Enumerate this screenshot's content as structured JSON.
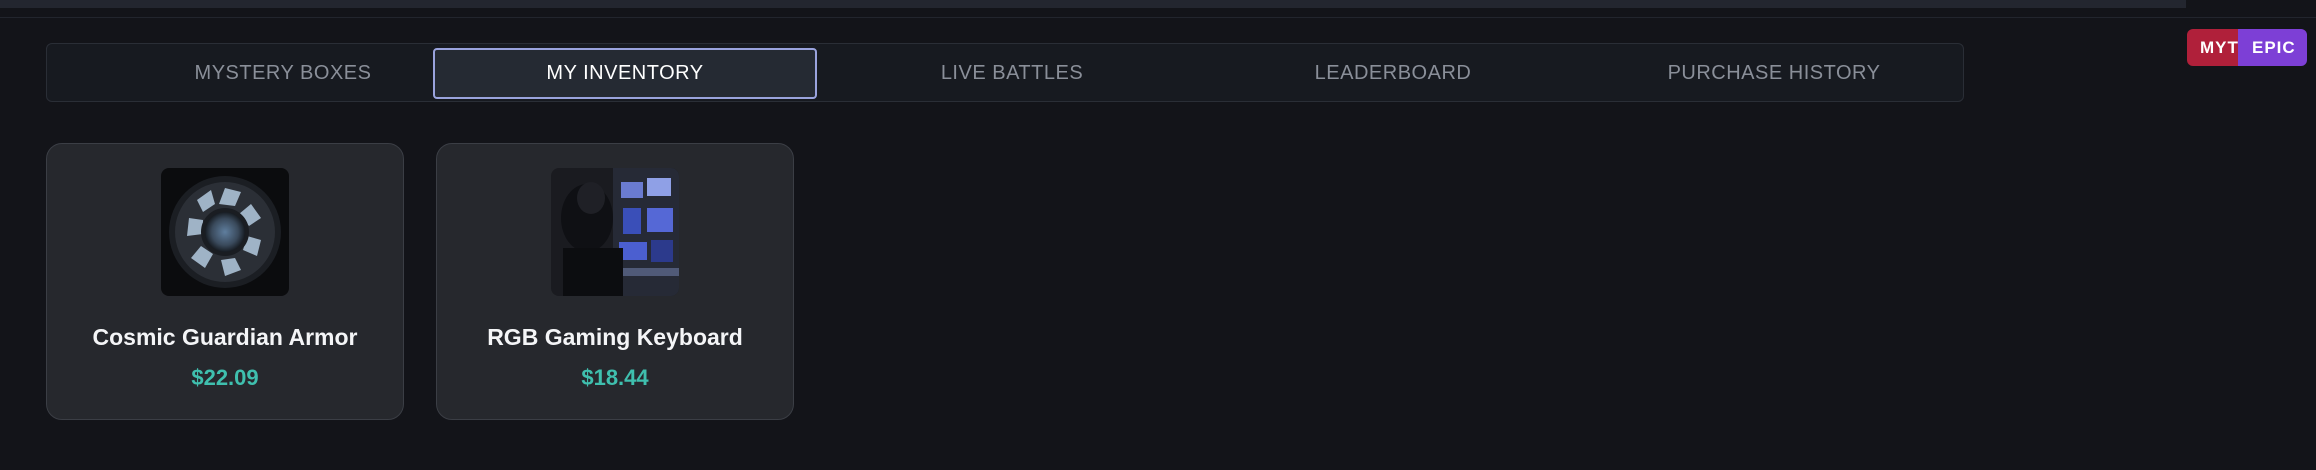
{
  "nav": {
    "tabs": [
      {
        "label": "MYSTERY BOXES",
        "active": false
      },
      {
        "label": "MY INVENTORY",
        "active": true
      },
      {
        "label": "LIVE BATTLES",
        "active": false
      },
      {
        "label": "LEADERBOARD",
        "active": false
      },
      {
        "label": "PURCHASE HISTORY",
        "active": false
      }
    ]
  },
  "badges": {
    "myth": "MYTH",
    "epic": "EPIC"
  },
  "inventory": {
    "items": [
      {
        "name": "Cosmic Guardian Armor",
        "price": "$22.09",
        "image_icon": "space-station-window-image"
      },
      {
        "name": "RGB Gaming Keyboard",
        "price": "$18.44",
        "image_icon": "gaming-setup-image"
      }
    ]
  },
  "colors": {
    "background": "#131419",
    "active_tab_border": "#9aa3dd",
    "price": "#3fbfae",
    "myth_badge": "#b0203a",
    "epic_badge": "#7d3fd6"
  }
}
